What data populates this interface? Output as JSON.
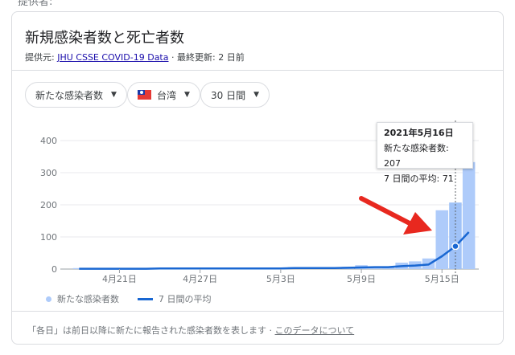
{
  "top_cut_text": "提供者:",
  "title": "新規感染者数と死亡者数",
  "source": {
    "prefix": "提供元:",
    "link": "JHU CSSE COVID-19 Data",
    "separator": "·",
    "updated": "最終更新: 2 日前"
  },
  "filters": [
    {
      "label": "新たな感染者数"
    },
    {
      "label": "台湾",
      "icon": "taiwan-flag-icon"
    },
    {
      "label": "30 日間"
    }
  ],
  "tooltip": {
    "date": "2021年5月16日",
    "cases_line": "新たな感染者数: 207",
    "avg_line": "7 日間の平均: 71"
  },
  "legend": {
    "cases": "新たな感染者数",
    "avg": "7 日間の平均"
  },
  "footer": {
    "text": "「各日」は前日以降に新たに報告された感染者数を表します",
    "separator": "·",
    "link": "このデータについて"
  },
  "colors": {
    "bar": "#aecbfa",
    "highlight_bar": "#a0c2f7",
    "line": "#1967d2",
    "arrow": "#e8281f"
  },
  "chart_data": {
    "type": "bar",
    "title": "新規感染者数と死亡者数",
    "x_ticks": [
      "4月21日",
      "4月27日",
      "5月3日",
      "5月9日",
      "5月15日"
    ],
    "tick_indices": [
      3,
      9,
      15,
      21,
      27
    ],
    "y_ticks": [
      0,
      100,
      200,
      300,
      400
    ],
    "ylim": [
      0,
      400
    ],
    "grid": true,
    "legend_position": "bottom-left",
    "highlight_index": 28,
    "series": [
      {
        "name": "新たな感染者数",
        "kind": "bar",
        "values": [
          3,
          1,
          2,
          1,
          2,
          0,
          2,
          3,
          2,
          1,
          3,
          2,
          2,
          4,
          1,
          3,
          6,
          5,
          4,
          6,
          7,
          12,
          3,
          8,
          20,
          24,
          33,
          183,
          207,
          333
        ]
      },
      {
        "name": "7 日間の平均",
        "kind": "line",
        "values": [
          1,
          1,
          1,
          1,
          1,
          1,
          2,
          2,
          2,
          2,
          2,
          2,
          2,
          2,
          2,
          2,
          3,
          3,
          3,
          3,
          4,
          5,
          6,
          6,
          9,
          11,
          14,
          40,
          71,
          115
        ]
      }
    ]
  }
}
